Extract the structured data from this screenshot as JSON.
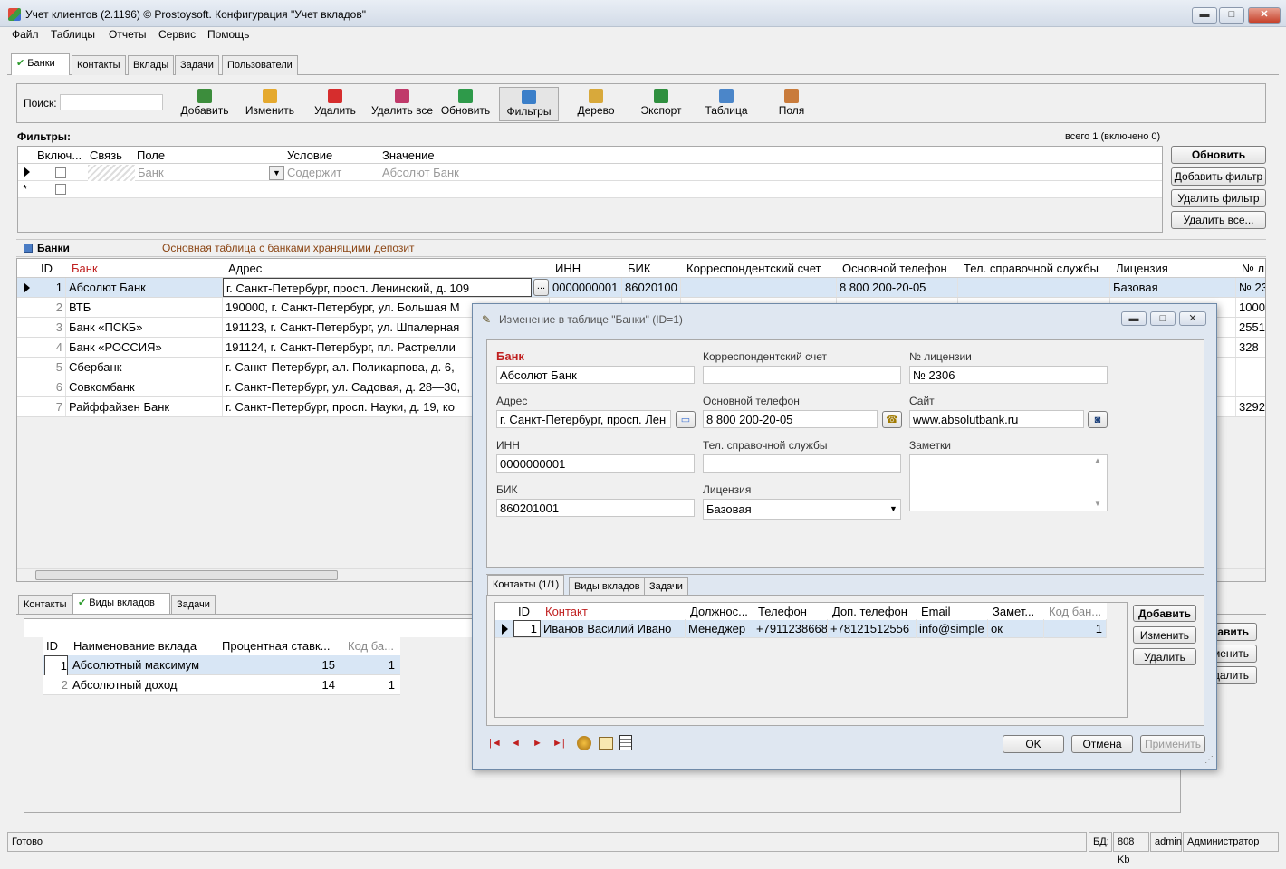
{
  "window": {
    "title": "Учет клиентов (2.1196) © Prostoysoft. Конфигурация \"Учет вкладов\"",
    "btn_min": "▬",
    "btn_max": "□",
    "btn_close": "✕"
  },
  "menu": [
    "Файл",
    "Таблицы",
    "Отчеты",
    "Сервис",
    "Помощь"
  ],
  "main_tabs": [
    "Банки",
    "Контакты",
    "Вклады",
    "Задачи",
    "Пользователи"
  ],
  "search": {
    "label": "Поиск:",
    "value": ""
  },
  "toolbar": [
    {
      "label": "Добавить",
      "icon": "add-icon",
      "color": "#3c8d3c"
    },
    {
      "label": "Изменить",
      "icon": "pencil-icon",
      "color": "#e5a92e"
    },
    {
      "label": "Удалить",
      "icon": "delete-icon",
      "color": "#d62d2d"
    },
    {
      "label": "Удалить все",
      "icon": "delete-all-icon",
      "color": "#c03a6a"
    },
    {
      "label": "Обновить",
      "icon": "refresh-icon",
      "color": "#2e9a4a"
    },
    {
      "label": "Фильтры",
      "icon": "filter-icon",
      "color": "#3b7fc9"
    },
    {
      "label": "Дерево",
      "icon": "tree-icon",
      "color": "#d8a93b"
    },
    {
      "label": "Экспорт",
      "icon": "export-icon",
      "color": "#2f8f3f"
    },
    {
      "label": "Таблица",
      "icon": "table-icon",
      "color": "#4b86c9"
    },
    {
      "label": "Поля",
      "icon": "fields-icon",
      "color": "#c97b3b"
    }
  ],
  "filters": {
    "title": "Фильтры:",
    "summary": "всего 1 (включено 0)",
    "columns": [
      "Включ...",
      "Связь",
      "Поле",
      "Условие",
      "Значение"
    ],
    "row": {
      "field": "Банк",
      "condition": "Содержит",
      "value": "Абсолют Банк"
    },
    "new_row_marker": "*",
    "buttons": [
      "Обновить",
      "Добавить фильтр",
      "Удалить фильтр",
      "Удалить все..."
    ]
  },
  "banks": {
    "title": "Банки",
    "subtitle": "Основная таблица с банками хранящими депозит",
    "columns": [
      "ID",
      "Банк",
      "Адрес",
      "ИНН",
      "БИК",
      "Корреспондентский счет",
      "Основной телефон",
      "Тел. справочной службы",
      "Лицензия",
      "№ ли"
    ],
    "rows": [
      {
        "id": "1",
        "bank": "Абсолют Банк",
        "address": "г. Санкт-Петербург, просп. Ленинский, д. 109",
        "inn": "0000000001",
        "bik": "86020100",
        "phone": "8 800 200-20-05",
        "license": "Базовая",
        "no": "№ 23"
      },
      {
        "id": "2",
        "bank": "ВТБ",
        "address": "190000, г. Санкт-Петербург, ул. Большая М",
        "inn": "",
        "bik": "",
        "phone": "",
        "license": "",
        "no": "1000"
      },
      {
        "id": "3",
        "bank": "Банк «ПСКБ»",
        "address": "191123, г. Санкт-Петербург, ул. Шпалерная",
        "inn": "",
        "bik": "",
        "phone": "",
        "license": "",
        "no": "2551"
      },
      {
        "id": "4",
        "bank": "Банк «РОССИЯ»",
        "address": "191124, г. Санкт-Петербург, пл. Растрелли",
        "inn": "",
        "bik": "",
        "phone": "",
        "license": "",
        "no": "328"
      },
      {
        "id": "5",
        "bank": "Сбербанк",
        "address": "г. Санкт-Петербург, ал. Поликарпова, д. 6,",
        "inn": "",
        "bik": "",
        "phone": "",
        "license": "",
        "no": ""
      },
      {
        "id": "6",
        "bank": "Совкомбанк",
        "address": "г. Санкт-Петербург, ул. Садовая, д. 28—30,",
        "inn": "",
        "bik": "",
        "phone": "",
        "license": "",
        "no": ""
      },
      {
        "id": "7",
        "bank": "Райффайзен Банк",
        "address": "г. Санкт-Петербург, просп. Науки, д. 19, ко",
        "inn": "",
        "bik": "",
        "phone": "",
        "license": "",
        "no": "3292"
      }
    ],
    "ellipsis": "..."
  },
  "bottom_tabs": [
    "Контакты",
    "Виды вкладов",
    "Задачи"
  ],
  "deposits": {
    "columns": [
      "ID",
      "Наименование вклада",
      "Процентная ставк...",
      "Код ба..."
    ],
    "rows": [
      {
        "id": "1",
        "name": "Абсолютный максимум",
        "rate": "15",
        "code": "1"
      },
      {
        "id": "2",
        "name": "Абсолютный доход",
        "rate": "14",
        "code": "1"
      }
    ],
    "buttons": [
      "Добавить",
      "Изменить",
      "Удалить"
    ]
  },
  "dialog": {
    "title": "Изменение в таблице \"Банки\" (ID=1)",
    "fields": {
      "bank_label": "Банк",
      "bank": "Абсолют Банк",
      "corr_label": "Корреспондентский счет",
      "corr": "",
      "lic_no_label": "№ лицензии",
      "lic_no": "№ 2306",
      "address_label": "Адрес",
      "address": "г. Санкт-Петербург, просп. Ленинский, д. 109",
      "phone_label": "Основной телефон",
      "phone": "8 800 200-20-05",
      "site_label": "Сайт",
      "site": "www.absolutbank.ru",
      "inn_label": "ИНН",
      "inn": "0000000001",
      "help_label": "Тел. справочной службы",
      "help": "",
      "notes_label": "Заметки",
      "notes": "",
      "bik_label": "БИК",
      "bik": "860201001",
      "license_label": "Лицензия",
      "license": "Базовая"
    },
    "tabs": [
      "Контакты (1/1)",
      "Виды вкладов",
      "Задачи"
    ],
    "contacts": {
      "columns": [
        "ID",
        "Контакт",
        "Должнос...",
        "Телефон",
        "Доп. телефон",
        "Email",
        "Замет...",
        "Код бан..."
      ],
      "rows": [
        {
          "id": "1",
          "name": "Иванов Василий Ивано",
          "position": "Менеджер",
          "phone": "+7911238668",
          "phone2": "+78121512556",
          "email": "info@simple",
          "notes": "ок",
          "code": "1"
        }
      ],
      "buttons": [
        "Добавить",
        "Изменить",
        "Удалить"
      ]
    },
    "nav": [
      "|◄",
      "◄",
      "►",
      "►|"
    ],
    "ok": "OK",
    "cancel": "Отмена",
    "apply": "Применить"
  },
  "statusbar": {
    "status": "Готово",
    "db_label": "БД:",
    "db_size": "808 Kb",
    "user": "admin",
    "role": "Администратор"
  }
}
